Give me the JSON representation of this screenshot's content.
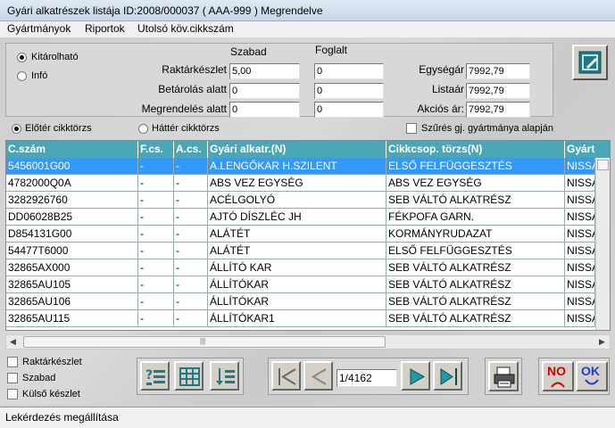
{
  "window": {
    "title": "Gyári alkatrészek listája  ID:2008/000037 ( AAA-999    )  Megrendelve"
  },
  "menu": [
    "Gyártmányok",
    "Riportok",
    "Utolsó köv.cikkszám"
  ],
  "panel": {
    "radio_options": [
      {
        "label": "Kitárolható",
        "selected": true
      },
      {
        "label": "Infó",
        "selected": false
      }
    ],
    "col_labels": {
      "szabad": "Szabad",
      "foglalt": "Foglalt"
    },
    "rows": [
      {
        "label": "Raktárkészlet",
        "szabad": "5,00",
        "foglalt": "0"
      },
      {
        "label": "Betárolás alatt",
        "szabad": "0",
        "foglalt": "0"
      },
      {
        "label": "Megrendelés alatt",
        "szabad": "0",
        "foglalt": "0"
      }
    ],
    "prices": [
      {
        "label": "Egységár",
        "value": "7992,79"
      },
      {
        "label": "Listaár",
        "value": "7992,79"
      },
      {
        "label": "Akciós ár:",
        "value": "7992,79"
      }
    ]
  },
  "options": {
    "elotér": {
      "label": "Előtér cikktörzs",
      "selected": true
    },
    "hatter": {
      "label": "Háttér cikktörzs",
      "selected": false
    },
    "szures": {
      "label": "Szűrés gj. gyártmánya alapján",
      "checked": false
    }
  },
  "grid": {
    "headers": [
      "C.szám",
      "F.cs.",
      "A.cs.",
      "Gyári alkatr.(N)",
      "Cikkcsop. törzs(N)",
      "Gyárt"
    ],
    "rows": [
      [
        "5456001G00",
        "-",
        "-",
        "A.LENGŐKAR H.SZILENT",
        "ELSŐ FELFÜGGESZTÉS",
        "NISSA"
      ],
      [
        "4782000Q0A",
        "-",
        "-",
        "ABS VEZ EGYSÉG",
        "ABS VEZ EGYSÉG",
        "NISSA"
      ],
      [
        "3282926760",
        "-",
        "-",
        "ACÉLGOLYÓ",
        "SEB VÁLTÓ ALKATRÉSZ",
        "NISSA"
      ],
      [
        "DD06028B25",
        "-",
        "-",
        "AJTÓ DÍSZLÉC JH",
        "FÉKPOFA GARN.",
        "NISSA"
      ],
      [
        "D854131G00",
        "-",
        "-",
        "ALÁTÉT",
        "KORMÁNYRUDAZAT",
        "NISSA"
      ],
      [
        "54477T6000",
        "-",
        "-",
        "ALÁTÉT",
        "ELSŐ FELFÜGGESZTÉS",
        "NISSA"
      ],
      [
        "32865AX000",
        "-",
        "-",
        "ÁLLÍTÓ KAR",
        "SEB VÁLTÓ ALKATRÉSZ",
        "NISSA"
      ],
      [
        "32865AU105",
        "-",
        "-",
        "ÁLLÍTÓKAR",
        "SEB VÁLTÓ ALKATRÉSZ",
        "NISSA"
      ],
      [
        "32865AU106",
        "-",
        "-",
        "ÁLLÍTÓKAR",
        "SEB VÁLTÓ ALKATRÉSZ",
        "NISSA"
      ],
      [
        "32865AU115",
        "-",
        "-",
        "ÁLLÍTÓKAR1",
        "SEB VÁLTÓ ALKATRÉSZ",
        "NISSA"
      ]
    ],
    "selected_row": 0
  },
  "filters": [
    {
      "label": "Raktárkészlet",
      "checked": false
    },
    {
      "label": "Szabad",
      "checked": false
    },
    {
      "label": "Külső készlet",
      "checked": false
    }
  ],
  "pager": {
    "value": "1/4162"
  },
  "buttons": {
    "no": "NO",
    "ok": "OK"
  },
  "status": {
    "text": "Lekérdezés megállítása"
  },
  "colors": {
    "header": "#4ba7b6",
    "selection": "#3399ff",
    "no_red": "#cc0000",
    "ok_blue": "#1a3fd6"
  }
}
